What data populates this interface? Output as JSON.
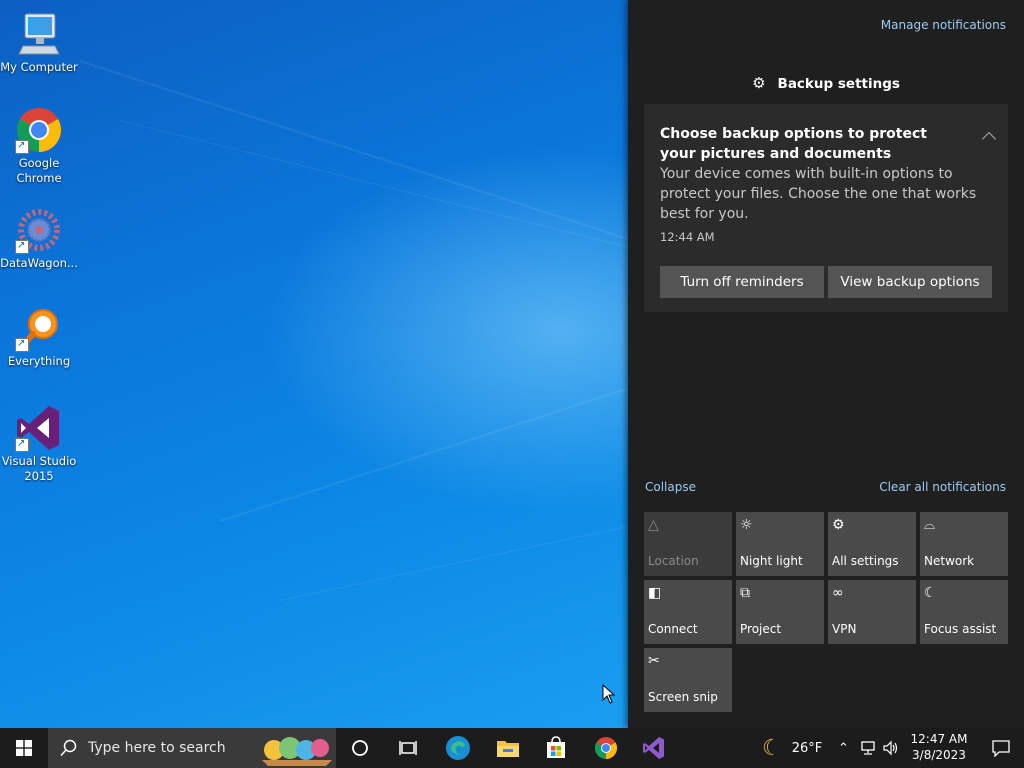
{
  "desktop": {
    "icons": [
      {
        "label": "My Computer",
        "icon": "computer-icon"
      },
      {
        "label": "Google Chrome",
        "icon": "chrome-icon"
      },
      {
        "label": "DataWagon...",
        "icon": "datawagon-icon"
      },
      {
        "label": "Everything",
        "icon": "everything-search-icon"
      },
      {
        "label": "Visual Studio 2015",
        "icon": "visual-studio-icon"
      }
    ]
  },
  "action_center": {
    "manage_notifications": "Manage notifications",
    "group_title": "Backup settings",
    "group_icon": "gear-icon",
    "notification": {
      "title": "Choose backup options to protect your pictures and documents",
      "body": "Your device comes with built-in options to protect your files. Choose the one that works best for you.",
      "time": "12:44 AM",
      "buttons": [
        "Turn off reminders",
        "View backup options"
      ]
    },
    "collapse_label": "Collapse",
    "clear_all_label": "Clear all notifications",
    "quick_actions": [
      {
        "label": "Location",
        "icon": "location-icon",
        "state": "off"
      },
      {
        "label": "Night light",
        "icon": "brightness-icon",
        "state": "on"
      },
      {
        "label": "All settings",
        "icon": "gear-icon",
        "state": "on"
      },
      {
        "label": "Network",
        "icon": "network-icon",
        "state": "on"
      },
      {
        "label": "Connect",
        "icon": "connect-icon",
        "state": "on"
      },
      {
        "label": "Project",
        "icon": "project-icon",
        "state": "on"
      },
      {
        "label": "VPN",
        "icon": "vpn-icon",
        "state": "on"
      },
      {
        "label": "Focus assist",
        "icon": "moon-icon",
        "state": "on"
      },
      {
        "label": "Screen snip",
        "icon": "screen-snip-icon",
        "state": "on"
      }
    ]
  },
  "taskbar": {
    "search_placeholder": "Type here to search",
    "pinned_apps": [
      "cortana-icon",
      "task-view-icon",
      "edge-icon",
      "file-explorer-icon",
      "microsoft-store-icon",
      "chrome-icon",
      "visual-studio-icon"
    ],
    "weather": {
      "temp": "26°F",
      "icon": "moon-icon"
    },
    "clock": {
      "time": "12:47 AM",
      "date": "3/8/2023"
    },
    "accent_color": "#0078d7"
  }
}
